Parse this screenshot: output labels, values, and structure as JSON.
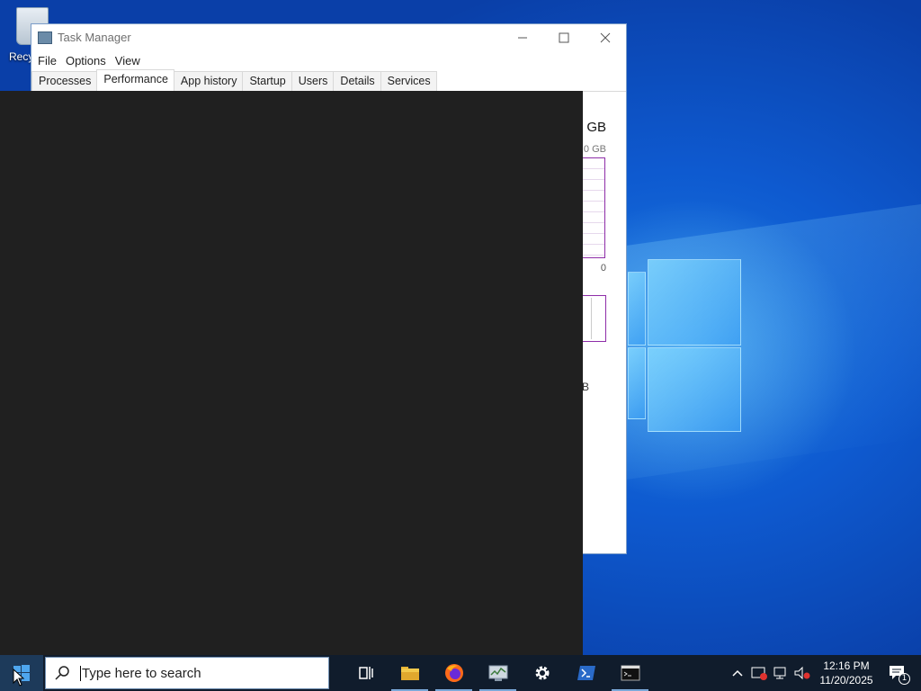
{
  "desktop": {
    "recycle_label": "Recy"
  },
  "task_manager": {
    "title": "Task Manager",
    "controls": {
      "minimize": "—",
      "maximize": "☐",
      "close": "✕"
    },
    "menu": [
      "File",
      "Options",
      "View"
    ],
    "tabs": [
      "Processes",
      "Performance",
      "App history",
      "Startup",
      "Users",
      "Details",
      "Services"
    ],
    "active_tab": "Performance",
    "memory": {
      "total": ") GB",
      "sub": ".0 GB",
      "zero": "0",
      "b_label": "B"
    }
  },
  "taskbar": {
    "search_placeholder": "Type here to search",
    "pinned": [
      "task-view",
      "file-explorer",
      "firefox",
      "task-manager",
      "settings",
      "powershell",
      "command-prompt"
    ],
    "clock_time": "12:16 PM",
    "clock_date": "11/20/2025",
    "notification_count": "1",
    "accent_color": "#7aa8d8"
  }
}
